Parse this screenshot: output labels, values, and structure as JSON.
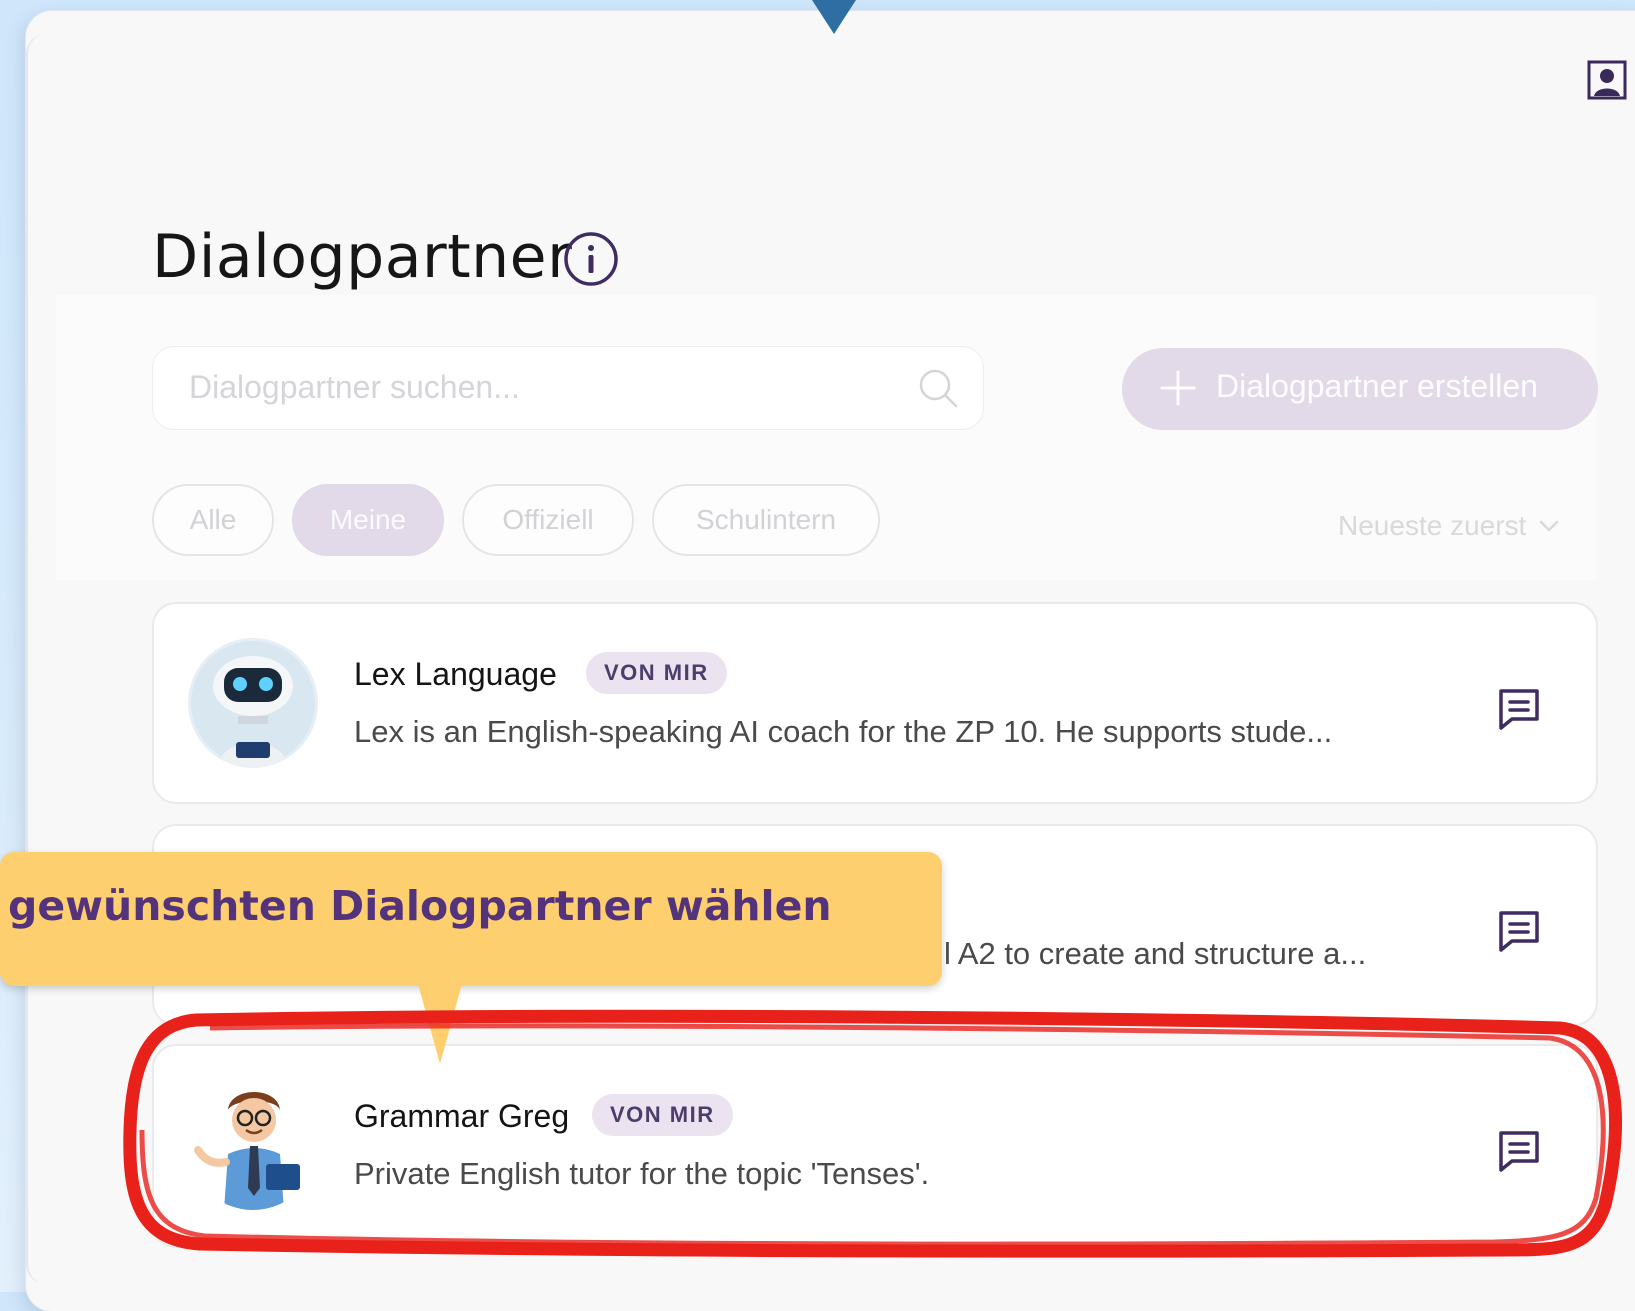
{
  "page": {
    "title": "Dialogpartner",
    "profile_icon": "person-square-icon",
    "info_icon": "info-circle-icon"
  },
  "search": {
    "placeholder": "Dialogpartner suchen...",
    "icon": "search-icon"
  },
  "create_button": {
    "label": "Dialogpartner erstellen",
    "icon": "plus-icon"
  },
  "filters": [
    {
      "label": "Alle",
      "active": false
    },
    {
      "label": "Meine",
      "active": true
    },
    {
      "label": "Offiziell",
      "active": false
    },
    {
      "label": "Schulintern",
      "active": false
    }
  ],
  "sort": {
    "label": "Neueste zuerst",
    "icon": "chevron-down-icon"
  },
  "partners": [
    {
      "name": "Lex Language",
      "badge": "VON MIR",
      "description": "Lex is an English-speaking AI coach for the ZP 10. He supports stude...",
      "avatar": "robot-avatar",
      "action_icon": "chat-icon"
    },
    {
      "name": "",
      "badge": "",
      "description": "l A2 to create and structure a...",
      "avatar": "",
      "action_icon": "chat-icon"
    },
    {
      "name": "Grammar Greg",
      "badge": "VON MIR",
      "description": "Private English tutor for the topic 'Tenses'.",
      "avatar": "teacher-cartoon-avatar",
      "action_icon": "chat-icon"
    }
  ],
  "annotation": {
    "callout_text": "gewünschten Dialogpartner wählen",
    "callout_color": "#fecf6e",
    "callout_text_color": "#54337d",
    "highlight_color": "#e8211a",
    "pointer_color": "#2f6ea3"
  },
  "colors": {
    "accent": "#4e3d6b",
    "badge_bg": "#ebe3f0",
    "active_chip": "#e2dae8"
  }
}
